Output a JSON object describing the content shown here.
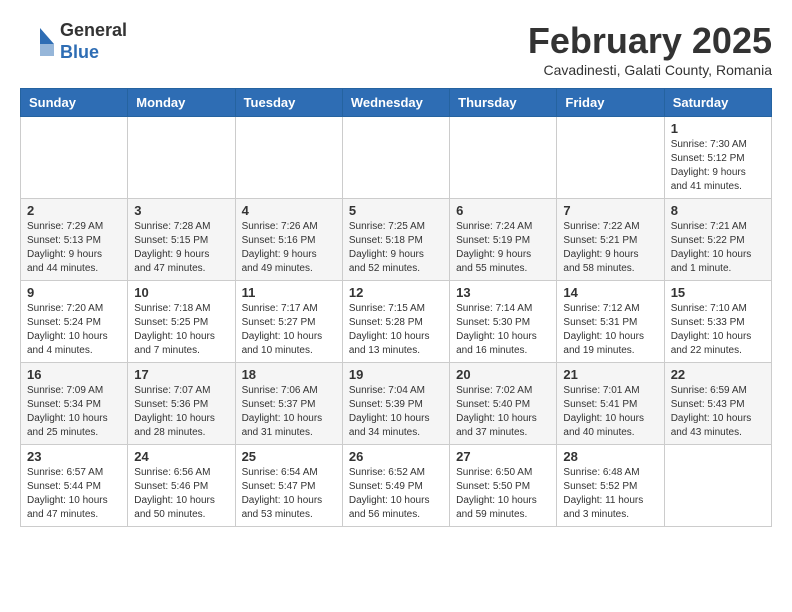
{
  "header": {
    "logo_line1": "General",
    "logo_line2": "Blue",
    "month_title": "February 2025",
    "subtitle": "Cavadinesti, Galati County, Romania"
  },
  "weekdays": [
    "Sunday",
    "Monday",
    "Tuesday",
    "Wednesday",
    "Thursday",
    "Friday",
    "Saturday"
  ],
  "weeks": [
    [
      {
        "day": "",
        "info": ""
      },
      {
        "day": "",
        "info": ""
      },
      {
        "day": "",
        "info": ""
      },
      {
        "day": "",
        "info": ""
      },
      {
        "day": "",
        "info": ""
      },
      {
        "day": "",
        "info": ""
      },
      {
        "day": "1",
        "info": "Sunrise: 7:30 AM\nSunset: 5:12 PM\nDaylight: 9 hours and 41 minutes."
      }
    ],
    [
      {
        "day": "2",
        "info": "Sunrise: 7:29 AM\nSunset: 5:13 PM\nDaylight: 9 hours and 44 minutes."
      },
      {
        "day": "3",
        "info": "Sunrise: 7:28 AM\nSunset: 5:15 PM\nDaylight: 9 hours and 47 minutes."
      },
      {
        "day": "4",
        "info": "Sunrise: 7:26 AM\nSunset: 5:16 PM\nDaylight: 9 hours and 49 minutes."
      },
      {
        "day": "5",
        "info": "Sunrise: 7:25 AM\nSunset: 5:18 PM\nDaylight: 9 hours and 52 minutes."
      },
      {
        "day": "6",
        "info": "Sunrise: 7:24 AM\nSunset: 5:19 PM\nDaylight: 9 hours and 55 minutes."
      },
      {
        "day": "7",
        "info": "Sunrise: 7:22 AM\nSunset: 5:21 PM\nDaylight: 9 hours and 58 minutes."
      },
      {
        "day": "8",
        "info": "Sunrise: 7:21 AM\nSunset: 5:22 PM\nDaylight: 10 hours and 1 minute."
      }
    ],
    [
      {
        "day": "9",
        "info": "Sunrise: 7:20 AM\nSunset: 5:24 PM\nDaylight: 10 hours and 4 minutes."
      },
      {
        "day": "10",
        "info": "Sunrise: 7:18 AM\nSunset: 5:25 PM\nDaylight: 10 hours and 7 minutes."
      },
      {
        "day": "11",
        "info": "Sunrise: 7:17 AM\nSunset: 5:27 PM\nDaylight: 10 hours and 10 minutes."
      },
      {
        "day": "12",
        "info": "Sunrise: 7:15 AM\nSunset: 5:28 PM\nDaylight: 10 hours and 13 minutes."
      },
      {
        "day": "13",
        "info": "Sunrise: 7:14 AM\nSunset: 5:30 PM\nDaylight: 10 hours and 16 minutes."
      },
      {
        "day": "14",
        "info": "Sunrise: 7:12 AM\nSunset: 5:31 PM\nDaylight: 10 hours and 19 minutes."
      },
      {
        "day": "15",
        "info": "Sunrise: 7:10 AM\nSunset: 5:33 PM\nDaylight: 10 hours and 22 minutes."
      }
    ],
    [
      {
        "day": "16",
        "info": "Sunrise: 7:09 AM\nSunset: 5:34 PM\nDaylight: 10 hours and 25 minutes."
      },
      {
        "day": "17",
        "info": "Sunrise: 7:07 AM\nSunset: 5:36 PM\nDaylight: 10 hours and 28 minutes."
      },
      {
        "day": "18",
        "info": "Sunrise: 7:06 AM\nSunset: 5:37 PM\nDaylight: 10 hours and 31 minutes."
      },
      {
        "day": "19",
        "info": "Sunrise: 7:04 AM\nSunset: 5:39 PM\nDaylight: 10 hours and 34 minutes."
      },
      {
        "day": "20",
        "info": "Sunrise: 7:02 AM\nSunset: 5:40 PM\nDaylight: 10 hours and 37 minutes."
      },
      {
        "day": "21",
        "info": "Sunrise: 7:01 AM\nSunset: 5:41 PM\nDaylight: 10 hours and 40 minutes."
      },
      {
        "day": "22",
        "info": "Sunrise: 6:59 AM\nSunset: 5:43 PM\nDaylight: 10 hours and 43 minutes."
      }
    ],
    [
      {
        "day": "23",
        "info": "Sunrise: 6:57 AM\nSunset: 5:44 PM\nDaylight: 10 hours and 47 minutes."
      },
      {
        "day": "24",
        "info": "Sunrise: 6:56 AM\nSunset: 5:46 PM\nDaylight: 10 hours and 50 minutes."
      },
      {
        "day": "25",
        "info": "Sunrise: 6:54 AM\nSunset: 5:47 PM\nDaylight: 10 hours and 53 minutes."
      },
      {
        "day": "26",
        "info": "Sunrise: 6:52 AM\nSunset: 5:49 PM\nDaylight: 10 hours and 56 minutes."
      },
      {
        "day": "27",
        "info": "Sunrise: 6:50 AM\nSunset: 5:50 PM\nDaylight: 10 hours and 59 minutes."
      },
      {
        "day": "28",
        "info": "Sunrise: 6:48 AM\nSunset: 5:52 PM\nDaylight: 11 hours and 3 minutes."
      },
      {
        "day": "",
        "info": ""
      }
    ]
  ]
}
